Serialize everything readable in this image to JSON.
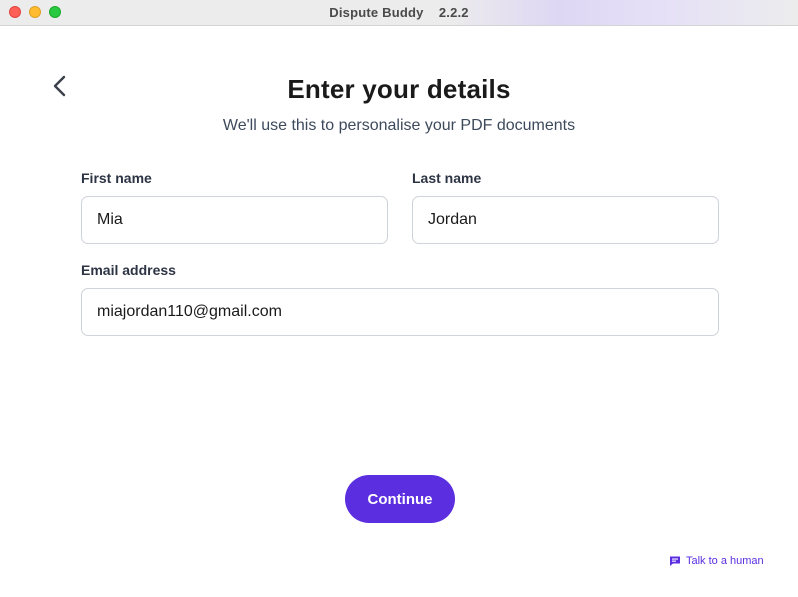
{
  "window": {
    "title": "Dispute Buddy    2.2.2"
  },
  "page": {
    "title": "Enter your details",
    "subtitle": "We'll use this to personalise your PDF documents"
  },
  "form": {
    "first_name": {
      "label": "First name",
      "value": "Mia"
    },
    "last_name": {
      "label": "Last name",
      "value": "Jordan"
    },
    "email": {
      "label": "Email address",
      "value": "miajordan110@gmail.com"
    }
  },
  "actions": {
    "continue_label": "Continue",
    "help_label": "Talk to a human"
  },
  "icons": {
    "back": "chevron-left-icon",
    "help": "chat-bubble-icon"
  },
  "colors": {
    "accent": "#5b2ee0",
    "title_text": "#1a1a1a",
    "label_text": "#2c3444",
    "input_border": "#cfd3da"
  }
}
